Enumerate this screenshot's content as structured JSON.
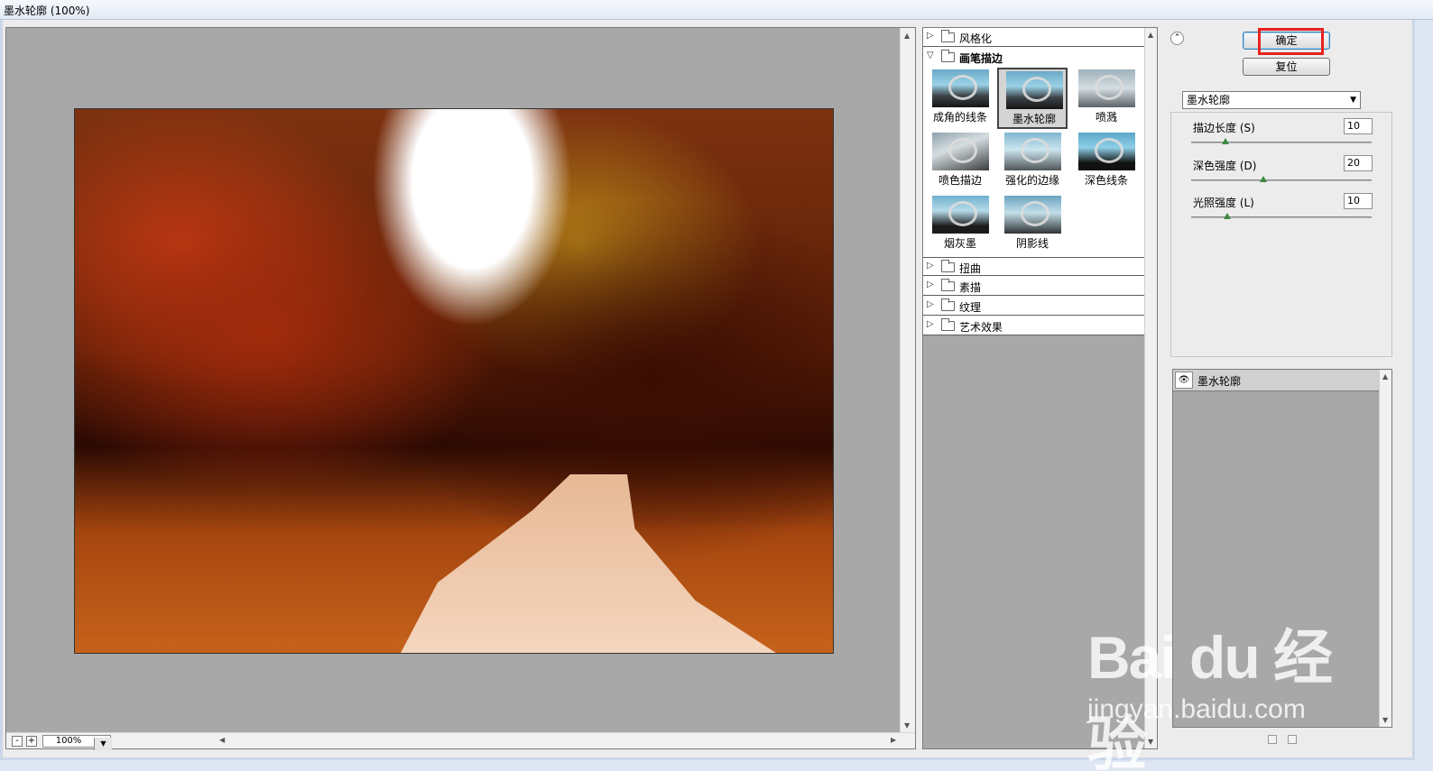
{
  "window": {
    "title": "墨水轮廓 (100%)"
  },
  "preview": {
    "zoom": "100%",
    "zoom_out": "-",
    "zoom_in": "+"
  },
  "gallery": {
    "categories": [
      {
        "label": "风格化",
        "open": false
      },
      {
        "label": "画笔描边",
        "open": true
      },
      {
        "label": "扭曲",
        "open": false
      },
      {
        "label": "素描",
        "open": false
      },
      {
        "label": "纹理",
        "open": false
      },
      {
        "label": "艺术效果",
        "open": false
      }
    ],
    "thumbnails": [
      {
        "label": "成角的线条",
        "selected": false
      },
      {
        "label": "墨水轮廓",
        "selected": true
      },
      {
        "label": "喷溅",
        "selected": false
      },
      {
        "label": "喷色描边",
        "selected": false
      },
      {
        "label": "强化的边缘",
        "selected": false
      },
      {
        "label": "深色线条",
        "selected": false
      },
      {
        "label": "烟灰墨",
        "selected": false
      },
      {
        "label": "阴影线",
        "selected": false
      }
    ]
  },
  "buttons": {
    "ok": "确定",
    "reset": "复位"
  },
  "filter_select": {
    "value": "墨水轮廓"
  },
  "params": [
    {
      "label": "描边长度 (S)",
      "value": "10",
      "fraction": 0.19
    },
    {
      "label": "深色强度 (D)",
      "value": "20",
      "fraction": 0.4
    },
    {
      "label": "光照强度 (L)",
      "value": "10",
      "fraction": 0.2
    }
  ],
  "layers": [
    {
      "name": "墨水轮廓",
      "visible": true
    }
  ],
  "watermark": {
    "main": "Bai du 经验",
    "sub": "jingyan.baidu.com"
  },
  "colors": {
    "highlight": "#e8211e",
    "knob": "#3c8a45"
  }
}
